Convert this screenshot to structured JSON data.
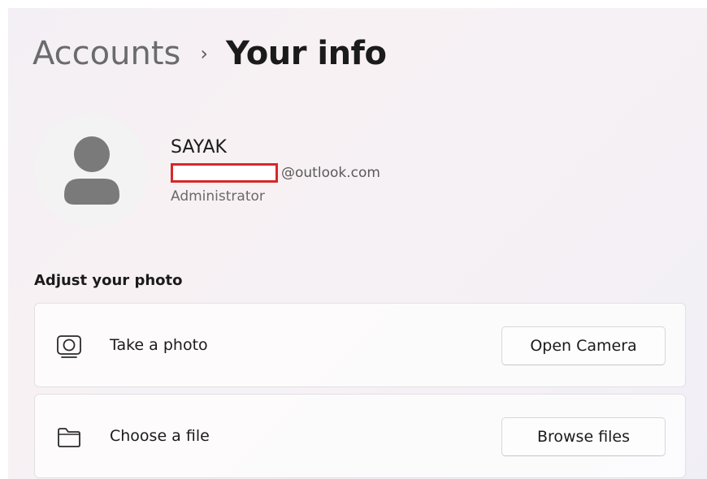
{
  "breadcrumb": {
    "parent": "Accounts",
    "separator": "›",
    "current": "Your info"
  },
  "profile": {
    "name": "SAYAK",
    "email_domain": "@outlook.com",
    "role": "Administrator"
  },
  "adjust_photo": {
    "title": "Adjust your photo",
    "take_photo": {
      "label": "Take a photo",
      "button": "Open Camera",
      "icon": "camera-icon"
    },
    "choose_file": {
      "label": "Choose a file",
      "button": "Browse files",
      "icon": "folder-icon"
    }
  },
  "colors": {
    "redaction": "#d62828",
    "avatar_bg": "#f4f3f3",
    "avatar_figure": "#7a7a7a"
  }
}
